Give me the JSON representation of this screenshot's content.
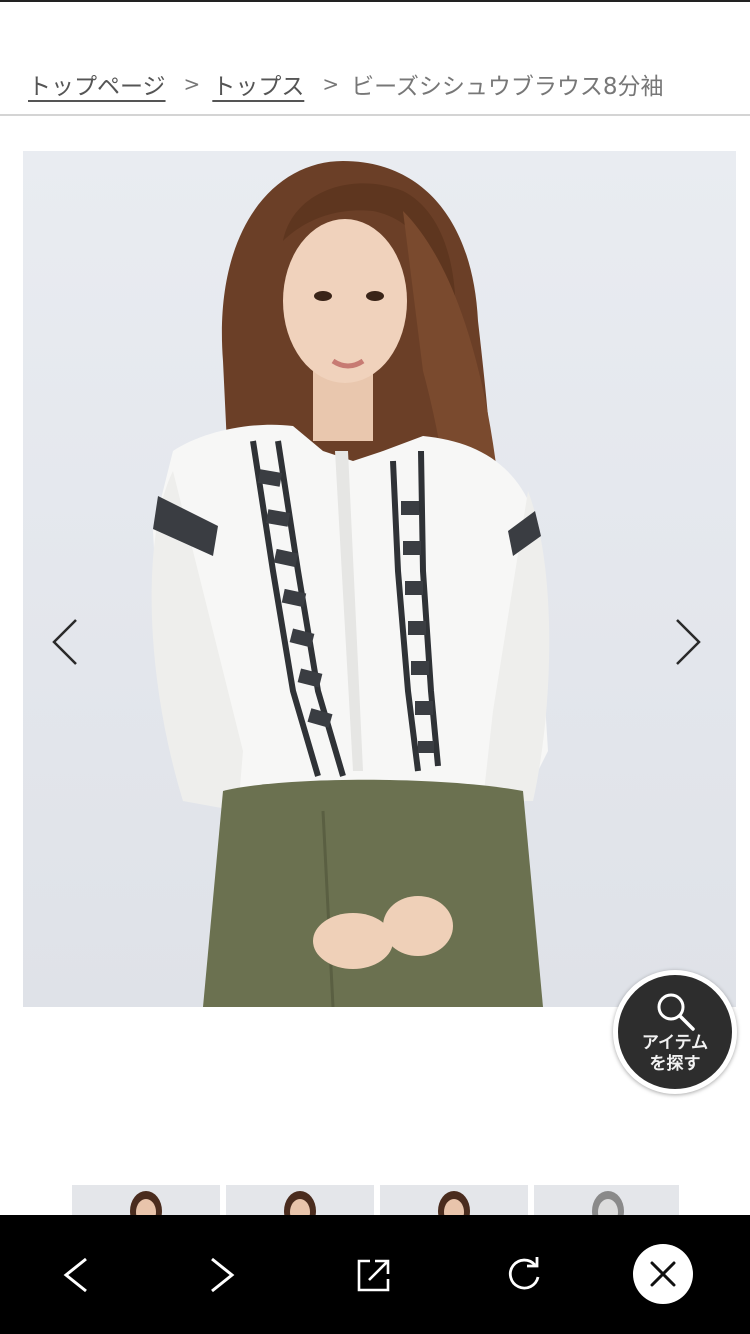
{
  "breadcrumb": {
    "items": [
      {
        "label": "トップページ",
        "link": true
      },
      {
        "label": "トップス",
        "link": true
      },
      {
        "label": "ビーズシシュウブラウス8分袖",
        "link": false
      }
    ],
    "separator": ">"
  },
  "gallery": {
    "image_alt": "ビーズシシュウブラウス8分袖",
    "prev_icon": "chevron-left-icon",
    "next_icon": "chevron-right-icon",
    "thumbnail_count": 4
  },
  "search_fab": {
    "line1": "アイテム",
    "line2": "を探す",
    "icon": "search-icon"
  },
  "bottom_bar": {
    "back_icon": "back-icon",
    "forward_icon": "forward-icon",
    "share_icon": "external-link-icon",
    "reload_icon": "reload-icon",
    "close_icon": "close-icon"
  },
  "colors": {
    "bar_bg": "#000000",
    "fab_bg": "#2d2d2d",
    "divider": "#d4d4d4"
  }
}
